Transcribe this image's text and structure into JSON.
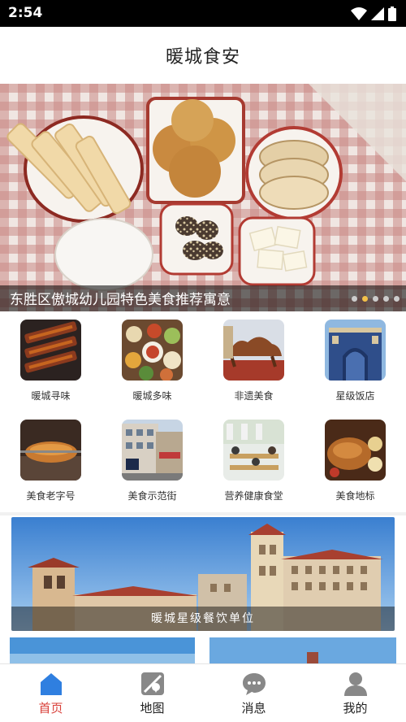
{
  "status_bar": {
    "time": "2:54"
  },
  "header": {
    "title": "暖城食安"
  },
  "banner": {
    "caption": "东胜区傲城幼儿园特色美食推荐寓意",
    "dot_count": 5,
    "active_dot": 1
  },
  "grid": {
    "items": [
      {
        "label": "暖城寻味"
      },
      {
        "label": "暖城多味"
      },
      {
        "label": "非遗美食"
      },
      {
        "label": "星级饭店"
      },
      {
        "label": "美食老字号"
      },
      {
        "label": "美食示范街"
      },
      {
        "label": "营养健康食堂"
      },
      {
        "label": "美食地标"
      }
    ]
  },
  "promo": {
    "label": "暖城星级餐饮单位"
  },
  "bottom_nav": {
    "items": [
      {
        "label": "首页",
        "icon": "home-icon",
        "active": true
      },
      {
        "label": "地图",
        "icon": "map-icon",
        "active": false
      },
      {
        "label": "消息",
        "icon": "chat-icon",
        "active": false
      },
      {
        "label": "我的",
        "icon": "user-icon",
        "active": false
      }
    ]
  },
  "colors": {
    "accent": "#d9403a",
    "nav_active_icon": "#2f7fe0",
    "nav_icon": "#888888",
    "dot_active": "#f3c14a"
  }
}
